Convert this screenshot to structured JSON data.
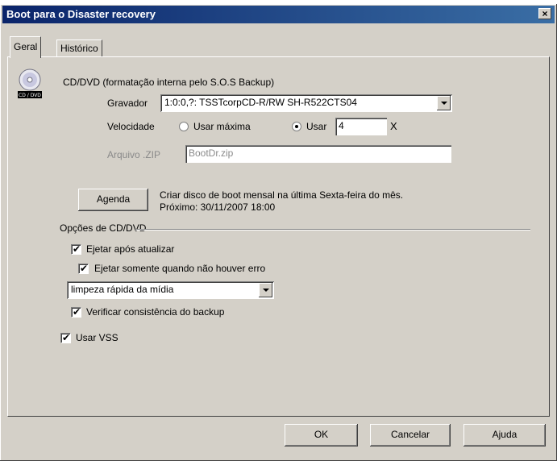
{
  "window": {
    "title": "Boot para o Disaster recovery",
    "close_label": "×"
  },
  "tabs": [
    {
      "label": "Geral",
      "active": true
    },
    {
      "label": "Histórico",
      "active": false
    }
  ],
  "cd": {
    "icon_label": "CD / DVD",
    "heading": "CD/DVD (formatação interna pelo S.O.S Backup)",
    "gravador_label": "Gravador",
    "gravador_value": "1:0:0,?: TSSTcorpCD-R/RW SH-R522CTS04",
    "velocidade_label": "Velocidade",
    "radio_max_label": "Usar máxima",
    "radio_usar_label": "Usar",
    "speed_value": "4",
    "speed_suffix": "X",
    "arquivo_label": "Arquivo .ZIP",
    "arquivo_value": "BootDr.zip"
  },
  "agenda": {
    "button_label": "Agenda",
    "line1": "Criar disco de boot mensal na última Sexta-feira do mês.",
    "line2": "Próximo: 30/11/2007 18:00"
  },
  "opcoes": {
    "group_label": "Opções de CD/DVD",
    "ejetar_label": "Ejetar após atualizar",
    "ejetar_erro_label": "Ejetar somente quando não houver erro",
    "limpeza_value": "limpeza rápida da mídia",
    "verificar_label": "Verificar consistência do backup",
    "vss_label": "Usar VSS"
  },
  "footer": {
    "ok": "OK",
    "cancel": "Cancelar",
    "help": "Ajuda"
  },
  "colors": {
    "titlebar_start": "#0a246a",
    "titlebar_end": "#3a6ea5",
    "face": "#d4d0c8"
  }
}
